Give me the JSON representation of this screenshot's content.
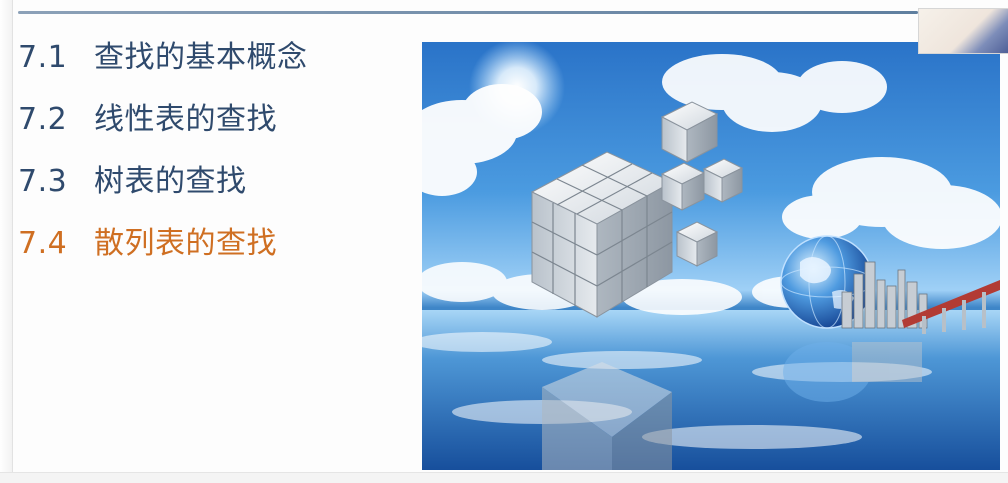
{
  "toc": {
    "items": [
      {
        "number": "7.1",
        "title": "查找的基本概念",
        "active": false
      },
      {
        "number": "7.2",
        "title": "线性表的查找",
        "active": false
      },
      {
        "number": "7.3",
        "title": "树表的查找",
        "active": false
      },
      {
        "number": "7.4",
        "title": "散列表的查找",
        "active": true
      }
    ]
  },
  "colors": {
    "toc_text": "#2f4a6d",
    "toc_active": "#cf6f22",
    "rule": "#6f8aa6"
  },
  "hero": {
    "icons": [
      "cube-cluster-icon",
      "globe-icon",
      "city-skyline-icon",
      "bridge-icon"
    ]
  }
}
